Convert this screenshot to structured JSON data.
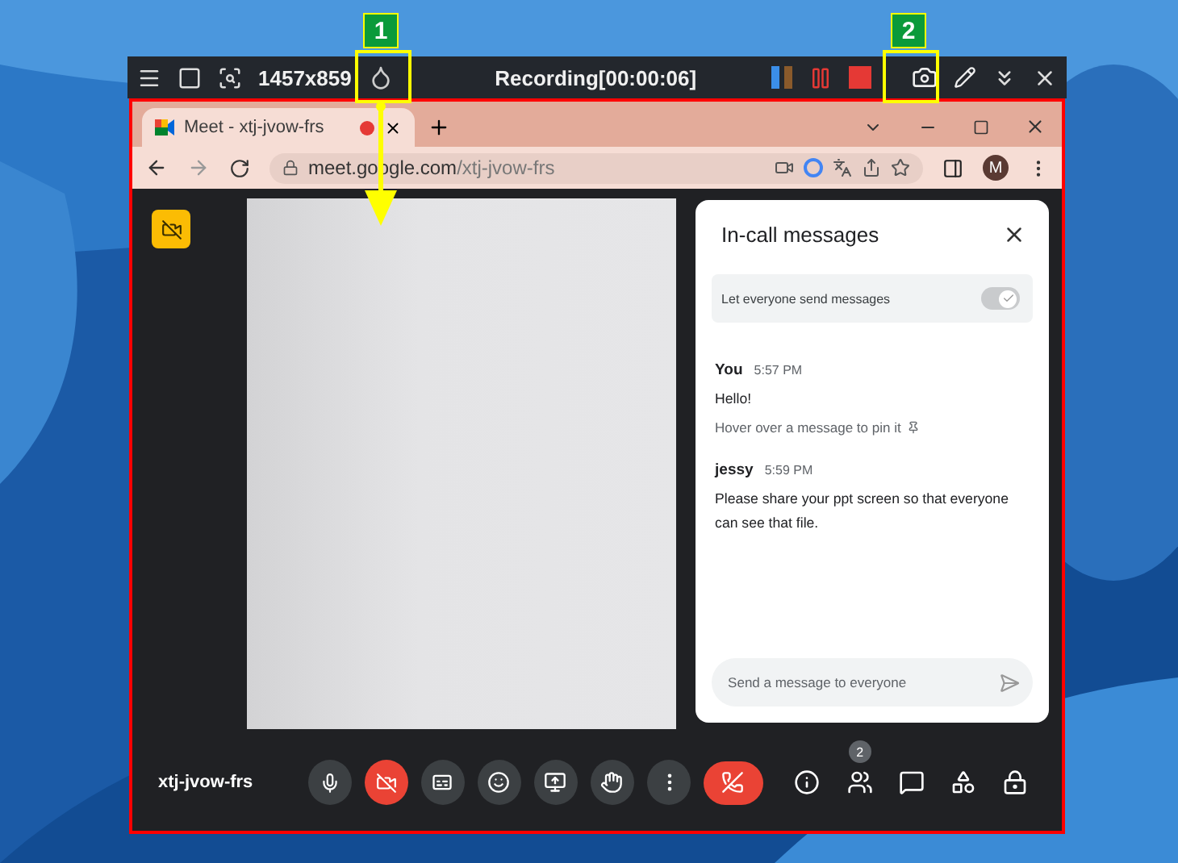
{
  "recorder": {
    "resolution": "1457x859",
    "status": "Recording[00:00:06]"
  },
  "annotations": [
    {
      "number": "1"
    },
    {
      "number": "2"
    }
  ],
  "browser": {
    "tab": {
      "title": "Meet - xtj-jvow-frs",
      "recording": true
    },
    "url_host": "meet.google.com",
    "url_path": "/xtj-jvow-frs",
    "profile_initial": "M"
  },
  "meet": {
    "meeting_code": "xtj-jvow-frs",
    "camera_on": false,
    "people_count": "2"
  },
  "chat": {
    "title": "In-call messages",
    "permission": {
      "label": "Let everyone send messages",
      "on": true
    },
    "messages": [
      {
        "sender": "You",
        "time": "5:57 PM",
        "text": "Hello!",
        "hint": "Hover over a message to pin it"
      },
      {
        "sender": "jessy",
        "time": "5:59 PM",
        "text": "Please share your ppt screen so that everyone can see that file."
      }
    ],
    "input": {
      "placeholder": "Send a message to everyone"
    }
  }
}
